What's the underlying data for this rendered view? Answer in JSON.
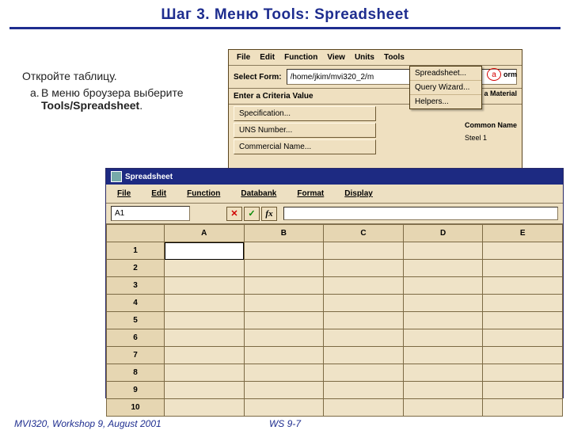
{
  "slide": {
    "title": "Шаг 3.  Меню Tools:  Spreadsheet"
  },
  "instructions": {
    "line1": "Откройте таблицу.",
    "sub_marker": "a.",
    "sub_text_1": "В меню броузера выберите ",
    "sub_bold": "Tools/Spreadsheet",
    "sub_tail": "."
  },
  "callout": {
    "label": "a"
  },
  "browser": {
    "menu": [
      "File",
      "Edit",
      "Function",
      "View",
      "Units",
      "Tools"
    ],
    "select_form_label": "Select Form:",
    "select_form_value": "/home/jkim/mvi320_2/m",
    "criteria_label": "Enter a Criteria Value",
    "criteria_buttons": [
      "Specification...",
      "UNS Number...",
      "Commercial Name..."
    ],
    "tools_dropdown": [
      "Spreadsheet...",
      "Query Wizard...",
      "Helpers..."
    ],
    "right_labels_top": "orm",
    "right_labels_mid": "a Material",
    "right_labels_1": "Common Name",
    "right_labels_2": "Steel 1"
  },
  "spreadsheet": {
    "title": "Spreadsheet",
    "menu": [
      "File",
      "Edit",
      "Function",
      "Databank",
      "Format",
      "Display"
    ],
    "cellref": "A1",
    "fx_cancel": "✕",
    "fx_confirm": "✓",
    "fx_label": "fx",
    "columns": [
      "A",
      "B",
      "C",
      "D",
      "E"
    ],
    "rows": [
      "1",
      "2",
      "3",
      "4",
      "5",
      "6",
      "7",
      "8",
      "9",
      "10"
    ]
  },
  "footer": {
    "left": "MVI320, Workshop 9, August 2001",
    "mid": "WS 9-7"
  }
}
